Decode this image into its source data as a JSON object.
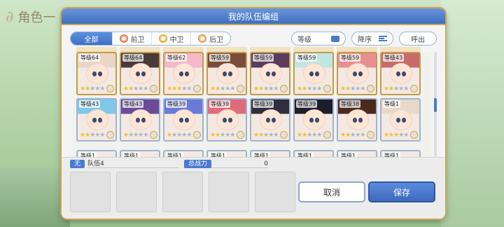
{
  "background": {
    "title": "角色一"
  },
  "dialog": {
    "title": "我的队伍编组"
  },
  "filters": {
    "tabs": [
      {
        "label": "全部",
        "active": true
      },
      {
        "label": "前卫",
        "active": false
      },
      {
        "label": "中卫",
        "active": false
      },
      {
        "label": "后卫",
        "active": false
      }
    ],
    "level_label": "等级",
    "sort_label": "降序",
    "call_label": "呼出"
  },
  "roster": {
    "rows": [
      [
        {
          "level": "等级64",
          "stars": 2,
          "frame": "gold"
        },
        {
          "level": "等级64",
          "stars": 2,
          "frame": "gold"
        },
        {
          "level": "等级62",
          "stars": 3,
          "frame": "gold"
        },
        {
          "level": "等级59",
          "stars": 2,
          "frame": "gold"
        },
        {
          "level": "等级59",
          "stars": 2,
          "frame": "gold"
        },
        {
          "level": "等级59",
          "stars": 2,
          "frame": "gold"
        },
        {
          "level": "等级59",
          "stars": 2,
          "frame": "gold"
        },
        {
          "level": "等级43",
          "stars": 2,
          "frame": "gold"
        }
      ],
      [
        {
          "level": "等级43",
          "stars": 2,
          "frame": "silver"
        },
        {
          "level": "等级43",
          "stars": 1,
          "frame": "silver"
        },
        {
          "level": "等级39",
          "stars": 1,
          "frame": "silver"
        },
        {
          "level": "等级39",
          "stars": 2,
          "frame": "silver"
        },
        {
          "level": "等级39",
          "stars": 2,
          "frame": "silver"
        },
        {
          "level": "等级39",
          "stars": 2,
          "frame": "silver"
        },
        {
          "level": "等级38",
          "stars": 2,
          "frame": "silver"
        },
        {
          "level": "等级1",
          "stars": 3,
          "frame": "silver"
        }
      ]
    ],
    "partial_row": [
      "等级1",
      "等级1",
      "等级1",
      "等级1",
      "等级1",
      "等级1",
      "等级1",
      "等级1"
    ]
  },
  "party": {
    "tag": "无",
    "name": "队伍4",
    "power_label": "总战力",
    "power_value": "0",
    "slots": 5
  },
  "buttons": {
    "cancel": "取消",
    "save": "保存"
  },
  "colors": {
    "accent": "#4a7ad0",
    "gold": "#c49b4c",
    "star": "#f1bf2a"
  }
}
